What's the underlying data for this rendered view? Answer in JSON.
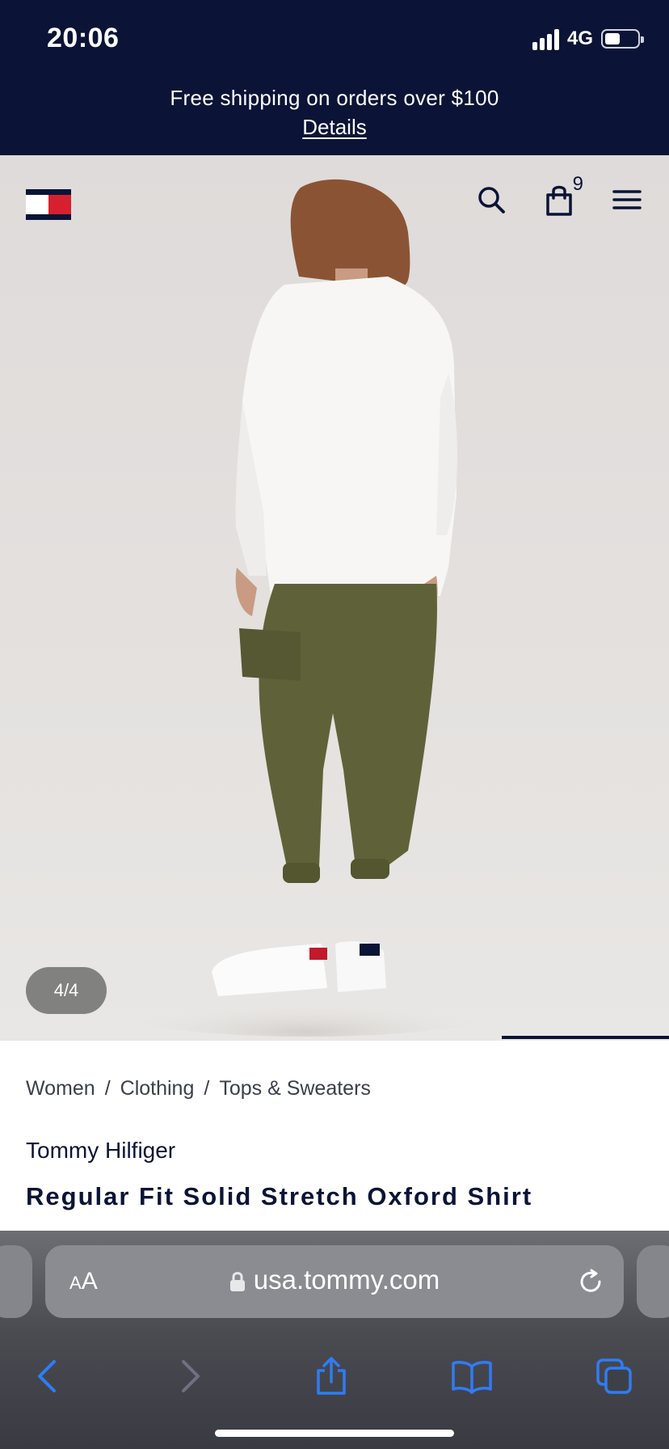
{
  "status_bar": {
    "time": "20:06",
    "network": "4G",
    "battery_level": 0.45
  },
  "promo": {
    "text": "Free shipping on orders over $100",
    "link": "Details"
  },
  "header": {
    "bag_count": "9"
  },
  "gallery": {
    "counter": "4/4",
    "progress_fraction": 0.25
  },
  "breadcrumb": [
    "Women",
    "Clothing",
    "Tops & Sweaters"
  ],
  "breadcrumb_separator": "/",
  "product": {
    "brand": "Tommy Hilfiger",
    "title": "Regular Fit Solid Stretch Oxford Shirt"
  },
  "browser": {
    "aa_small": "A",
    "aa_large": "A",
    "url": "usa.tommy.com"
  },
  "colors": {
    "navy": "#0b1436",
    "flag_red": "#d6202f",
    "ios_blue": "#2f7cf6"
  }
}
